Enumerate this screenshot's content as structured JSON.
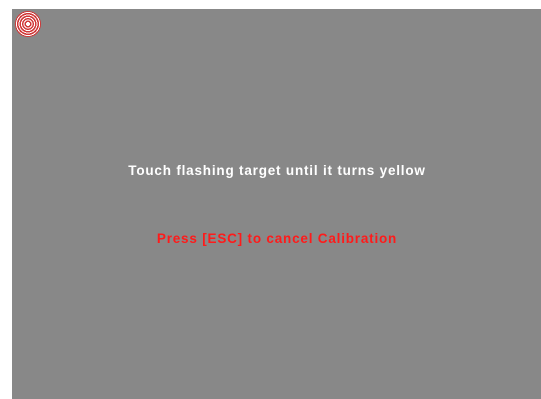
{
  "calibration": {
    "instruction": "Touch flashing target until it turns yellow",
    "cancel_hint": "Press [ESC] to cancel Calibration",
    "target_icon": "calibration-target-icon"
  },
  "colors": {
    "background": "#888888",
    "instruction_text": "#ffffff",
    "cancel_text": "#ff1a1a",
    "target": "#d03838"
  }
}
